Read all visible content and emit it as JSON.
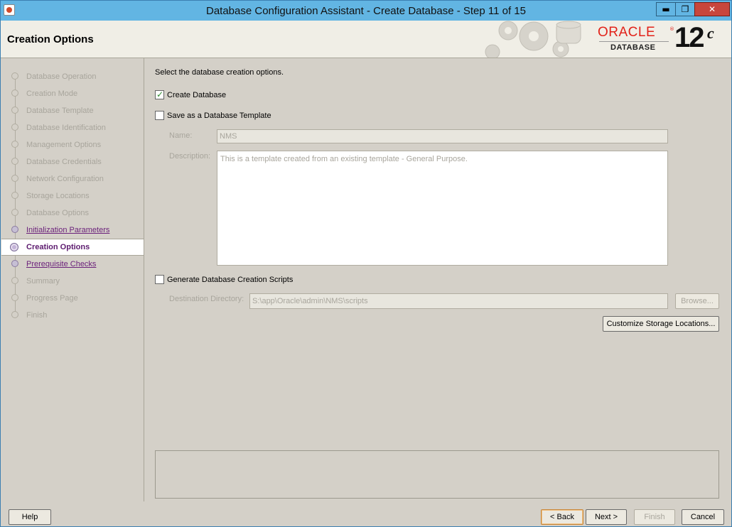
{
  "window": {
    "title": "Database Configuration Assistant - Create Database - Step 11 of 15"
  },
  "header": {
    "page_title": "Creation Options",
    "logo": {
      "brand": "ORACLE",
      "reg": "®",
      "product": "DATABASE",
      "version": "12",
      "version_suffix": "c"
    }
  },
  "sidebar": {
    "items": [
      {
        "label": "Database Operation",
        "state": "disabled"
      },
      {
        "label": "Creation Mode",
        "state": "disabled"
      },
      {
        "label": "Database Template",
        "state": "disabled"
      },
      {
        "label": "Database Identification",
        "state": "disabled"
      },
      {
        "label": "Management Options",
        "state": "disabled"
      },
      {
        "label": "Database Credentials",
        "state": "disabled"
      },
      {
        "label": "Network Configuration",
        "state": "disabled"
      },
      {
        "label": "Storage Locations",
        "state": "disabled"
      },
      {
        "label": "Database Options",
        "state": "disabled"
      },
      {
        "label": "Initialization Parameters",
        "state": "link"
      },
      {
        "label": "Creation Options",
        "state": "active"
      },
      {
        "label": "Prerequisite Checks",
        "state": "link"
      },
      {
        "label": "Summary",
        "state": "disabled"
      },
      {
        "label": "Progress Page",
        "state": "disabled"
      },
      {
        "label": "Finish",
        "state": "disabled"
      }
    ]
  },
  "main": {
    "instruction": "Select the database creation options.",
    "create_database": {
      "label": "Create Database",
      "checked": true
    },
    "save_template": {
      "label": "Save as a Database Template",
      "checked": false
    },
    "name_label": "Name:",
    "name_value": "NMS",
    "description_label": "Description:",
    "description_value": "This is a template created from an existing template - General Purpose.",
    "generate_scripts": {
      "label": "Generate Database Creation Scripts",
      "checked": false
    },
    "destination_label": "Destination Directory:",
    "destination_value": "S:\\app\\Oracle\\admin\\NMS\\scripts",
    "browse_label": "Browse...",
    "customize_label": "Customize Storage Locations..."
  },
  "footer": {
    "help": "Help",
    "back": "< Back",
    "next": "Next >",
    "finish": "Finish",
    "cancel": "Cancel"
  },
  "colors": {
    "titlebar": "#62b5e3",
    "close": "#c8463c",
    "oracle_red": "#e2231a",
    "link": "#6a1f7a",
    "active": "#5c1a6e"
  }
}
